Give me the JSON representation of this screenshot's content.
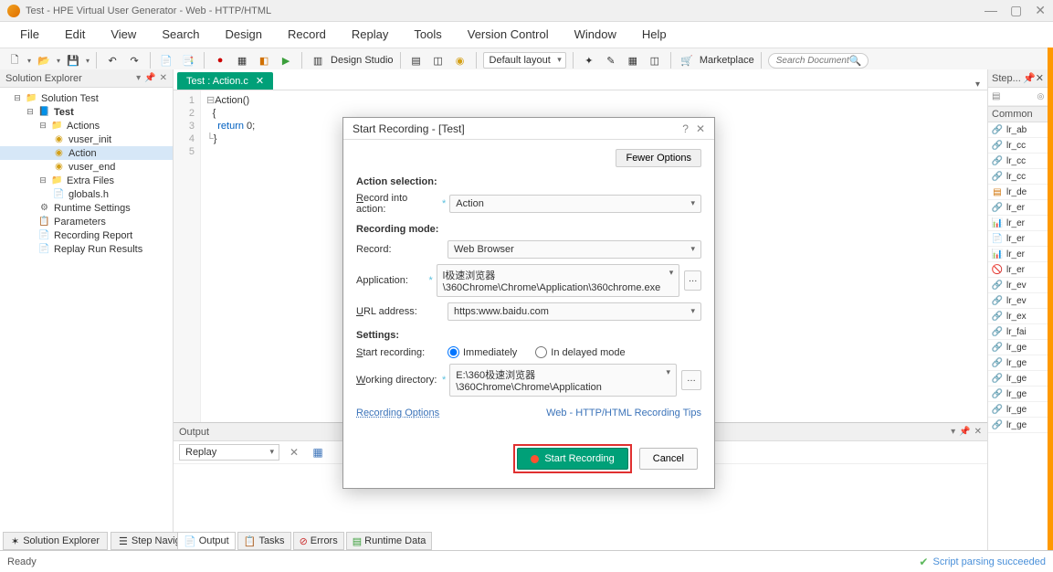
{
  "title_bar": "Test - HPE Virtual User Generator - Web - HTTP/HTML",
  "menu": [
    "File",
    "Edit",
    "View",
    "Search",
    "Design",
    "Record",
    "Replay",
    "Tools",
    "Version Control",
    "Window",
    "Help"
  ],
  "toolbar": {
    "design_studio": "Design Studio",
    "default_layout": "Default layout",
    "marketplace": "Marketplace",
    "search_placeholder": "Search Documentati"
  },
  "solution_explorer": {
    "title": "Solution Explorer",
    "root": "Solution Test",
    "script": "Test",
    "actions_label": "Actions",
    "actions": [
      "vuser_init",
      "Action",
      "vuser_end"
    ],
    "selected_action": "Action",
    "extra_files_label": "Extra Files",
    "extra_files": [
      "globals.h"
    ],
    "other": [
      "Runtime Settings",
      "Parameters",
      "Recording Report",
      "Replay Run Results"
    ]
  },
  "tab": {
    "name": "Test : Action.c"
  },
  "code": {
    "lines": [
      "1",
      "2",
      "3",
      "4",
      "5"
    ],
    "l1": "Action()",
    "l2": "{",
    "l3_indent": "    ",
    "l3_kw": "return",
    "l3_rest": " 0;",
    "l4": "}"
  },
  "output": {
    "title": "Output",
    "combo": "Replay",
    "tabs": [
      "Output",
      "Tasks",
      "Errors",
      "Runtime Data"
    ]
  },
  "bottom_left_tabs": [
    "Solution Explorer",
    "Step Navigator"
  ],
  "steps": {
    "title": "Step...",
    "section": "Common",
    "items": [
      "lr_ab",
      "lr_cc",
      "lr_cc",
      "lr_cc",
      "lr_de",
      "lr_er",
      "lr_er",
      "lr_er",
      "lr_er",
      "lr_er",
      "lr_ev",
      "lr_ev",
      "lr_ex",
      "lr_fai",
      "lr_ge",
      "lr_ge",
      "lr_ge",
      "lr_ge",
      "lr_ge",
      "lr_ge"
    ]
  },
  "status": {
    "left": "Ready",
    "right": "Script parsing succeeded"
  },
  "dialog": {
    "title": "Start Recording - [Test]",
    "fewer_options": "Fewer Options",
    "action_selection": "Action selection:",
    "record_into_label": "Record into action:",
    "record_into_value": "Action",
    "recording_mode": "Recording mode:",
    "record_label": "Record:",
    "record_value": "Web Browser",
    "application_label": "Application:",
    "application_value": "l极速浏览器\\360Chrome\\Chrome\\Application\\360chrome.exe",
    "url_label": "URL address:",
    "url_value": "https:www.baidu.com",
    "settings": "Settings:",
    "start_recording_label": "Start recording:",
    "radio_immediate": "Immediately",
    "radio_delayed": "In delayed mode",
    "wdir_label": "Working directory:",
    "wdir_value": "E:\\360极速浏览器\\360Chrome\\Chrome\\Application",
    "recording_options": "Recording Options",
    "tips": "Web - HTTP/HTML Recording Tips",
    "start_btn": "Start Recording",
    "cancel_btn": "Cancel"
  }
}
